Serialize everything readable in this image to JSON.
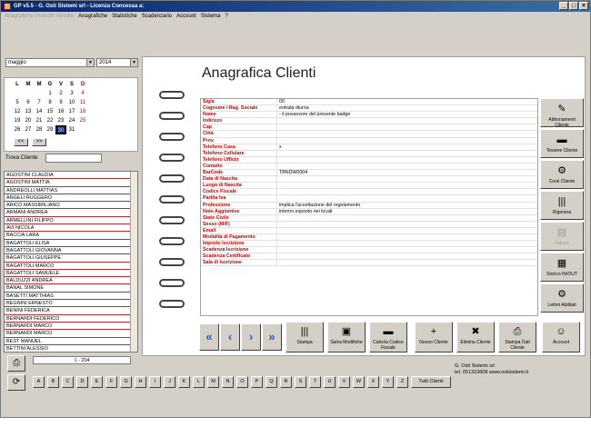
{
  "window": {
    "title": "GP v5.5 - G. Osti Sistemi srl - Licenza Concessa a:",
    "controls": [
      "_",
      "□",
      "×"
    ]
  },
  "menu": {
    "ghost": "Anagrafiche  Prodotti  Vendite",
    "items": [
      "Anagrafiche",
      "Statistiche",
      "Scadenzario",
      "Account",
      "Sistema",
      "?"
    ]
  },
  "calendar": {
    "month": "maggio",
    "year": "2014",
    "weekdays": [
      "L",
      "M",
      "M",
      "G",
      "V",
      "S",
      "D"
    ],
    "weeks": [
      [
        "",
        "",
        "",
        "1",
        "2",
        "3",
        "4"
      ],
      [
        "5",
        "6",
        "7",
        "8",
        "9",
        "10",
        "11"
      ],
      [
        "12",
        "13",
        "14",
        "15",
        "16",
        "17",
        "18"
      ],
      [
        "19",
        "20",
        "21",
        "22",
        "23",
        "24",
        "25"
      ],
      [
        "26",
        "27",
        "28",
        "29",
        "30",
        "31",
        ""
      ]
    ],
    "today": "30",
    "prev_label": "<<",
    "next_label": ">>"
  },
  "search": {
    "label": "Trova Cliente"
  },
  "clients": [
    "AGOSTINI CLAUDIA",
    "AGOSTINI MATTIA",
    "ANDREOLLI MATTIAS",
    "ANGELI RUGGERO",
    "ARICO MASSIMILIANO",
    "ARMANI ANDREA",
    "ARMELLINI FILIPPO",
    "AVI NICOLA",
    "BACCIA LARA",
    "BAGATTOLI ELISA",
    "BAGATTOLI GIOVANNA",
    "BAGATTOLI GIUSEPPE",
    "BAGATTOLI MARCO",
    "BAGATTOLI SAMUELE",
    "BALDUZZI ANDREA",
    "BANAL SIMONE",
    "BASETTI MATTHIAS",
    "BEGNINI ERNESTO",
    "BENINI FEDERICA",
    "BERNARDI FEDERICO",
    "BERNARDI MARCO",
    "BERNARDI MARCO",
    "BEST MANUEL",
    "BETTINI ALESSIO"
  ],
  "page": {
    "title": "Anagrafica Clienti"
  },
  "form": [
    {
      "label": "Sigla",
      "value": "00"
    },
    {
      "label": "Cognome / Rag. Sociale",
      "value": "entrata diurna"
    },
    {
      "label": "Nome",
      "value": "- il possesore del presente badge"
    },
    {
      "label": "Indirizzo",
      "value": ""
    },
    {
      "label": "Cap",
      "value": ""
    },
    {
      "label": "Città",
      "value": ""
    },
    {
      "label": "Prov.",
      "value": ""
    },
    {
      "label": "Telefono Casa",
      "value": "x"
    },
    {
      "label": "Telefono Cellulare",
      "value": ""
    },
    {
      "label": "Telefono Ufficio",
      "value": ""
    },
    {
      "label": "Contatto",
      "value": ""
    },
    {
      "label": "BarCode",
      "value": "TBNDW0004"
    },
    {
      "label": "Data di Nascita",
      "value": ""
    },
    {
      "label": "Luogo di Nascita",
      "value": ""
    },
    {
      "label": "Codice Fiscale",
      "value": ""
    },
    {
      "label": "Partita Iva",
      "value": ""
    },
    {
      "label": "Professione",
      "value": "implica l'accettazione del regolamento"
    },
    {
      "label": "Note Aggiuntive",
      "value": "interno esposto nei locali"
    },
    {
      "label": "Stato Civile",
      "value": ""
    },
    {
      "label": "Sesso (M/F)",
      "value": ""
    },
    {
      "label": "Email",
      "value": ""
    },
    {
      "label": "Modalità di Pagamento",
      "value": ""
    },
    {
      "label": "Importo Iscrizione",
      "value": ""
    },
    {
      "label": "Scadenza Iscrizione",
      "value": ""
    },
    {
      "label": "Scadenza Certificato",
      "value": ""
    },
    {
      "label": "Sala di Iscrizione",
      "value": ""
    }
  ],
  "side_buttons": [
    {
      "label": "Abbonamenti Cliente",
      "icon": "✎"
    },
    {
      "label": "Tessere Cliente",
      "icon": "▬"
    },
    {
      "label": "Corsi Cliente",
      "icon": "⚙"
    },
    {
      "label": "Rigenera",
      "icon": "|||"
    },
    {
      "label": "Fatture",
      "icon": "▤"
    },
    {
      "label": "Storico IN/OUT",
      "icon": "▦"
    },
    {
      "label": "Lettori Abilitati",
      "icon": "⚙"
    }
  ],
  "nav_buttons": [
    "«",
    "‹",
    "›",
    "»"
  ],
  "bottom_buttons": [
    {
      "label": "Stampa",
      "icon": "|||"
    },
    {
      "label": "Salva Modifiche",
      "icon": "▣"
    },
    {
      "label": "Calcola Codice Fiscale",
      "icon": "▬"
    },
    {
      "label": "Nuovo Cliente",
      "icon": "+"
    },
    {
      "label": "Elimina Cliente",
      "icon": "✖"
    },
    {
      "label": "Stampa Dati Cliente",
      "icon": "⎙"
    },
    {
      "label": "Account",
      "icon": "☺"
    }
  ],
  "counter": "1 - 204",
  "company": {
    "name": "G. Osti Sistemi srl",
    "contact": "tel. 051323608 www.ostisistemi.it"
  },
  "alphabet": [
    "A",
    "B",
    "C",
    "D",
    "E",
    "F",
    "G",
    "H",
    "I",
    "J",
    "K",
    "L",
    "M",
    "N",
    "O",
    "P",
    "Q",
    "R",
    "S",
    "T",
    "U",
    "V",
    "W",
    "X",
    "Y",
    "Z"
  ],
  "all_clients_label": "Tutti Clienti",
  "colors": {
    "titlebar": "#0a246a",
    "label_red": "#c00000",
    "accent_blue": "#2060c0",
    "face": "#d4d0c8"
  }
}
